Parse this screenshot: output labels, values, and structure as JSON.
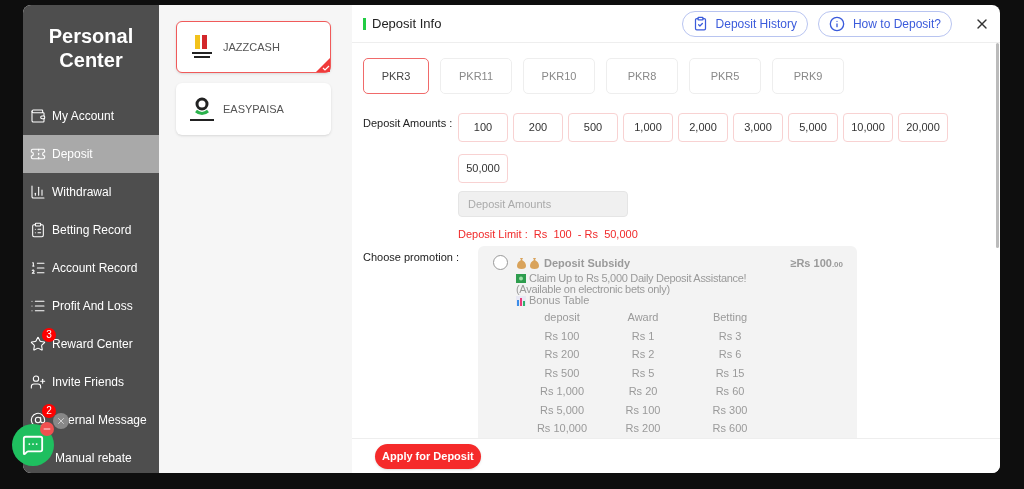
{
  "sidebar": {
    "title": "Personal Center",
    "items": [
      {
        "label": "My Account",
        "selected": false
      },
      {
        "label": "Deposit",
        "selected": true
      },
      {
        "label": "Withdrawal",
        "selected": false
      },
      {
        "label": "Betting Record",
        "selected": false
      },
      {
        "label": "Account Record",
        "selected": false
      },
      {
        "label": "Profit And Loss",
        "selected": false
      },
      {
        "label": "Reward Center",
        "selected": false,
        "badge": "3"
      },
      {
        "label": "Invite Friends",
        "selected": false
      },
      {
        "label": "ernal Message",
        "selected": false,
        "badge": "2"
      },
      {
        "label": "Manual rebate",
        "selected": false
      }
    ]
  },
  "channels": [
    {
      "name": "JAZZCASH",
      "selected": true
    },
    {
      "name": "EASYPAISA",
      "selected": false
    }
  ],
  "header": {
    "title": "Deposit Info",
    "buttons": [
      "Deposit History",
      "How to Deposit?"
    ]
  },
  "currencies": [
    {
      "label": "PKR3",
      "selected": true
    },
    {
      "label": "PKR11",
      "selected": false
    },
    {
      "label": "PKR10",
      "selected": false
    },
    {
      "label": "PKR8",
      "selected": false
    },
    {
      "label": "PKR5",
      "selected": false
    },
    {
      "label": "PRK9",
      "selected": false
    }
  ],
  "amounts": {
    "label": "Deposit Amounts :",
    "options": [
      "100",
      "200",
      "500",
      "1,000",
      "2,000",
      "3,000",
      "5,000",
      "10,000",
      "20,000",
      "50,000"
    ]
  },
  "amount_field": {
    "placeholder": "Deposit Amounts"
  },
  "limit": {
    "label": "Deposit Limit :",
    "range": "Rs  100  - Rs  50,000"
  },
  "promotion": {
    "label": "Choose promotion :",
    "card": {
      "checked": false,
      "title": "Deposit Subsidy",
      "min_prefix": "≥Rs",
      "min_amount": "100",
      "min_fraction": ".00",
      "claim": "Claim Up to Rs 5,000 Daily Deposit Assistance!",
      "note": "(Available on electronic bets only)",
      "table_title": "Bonus Table",
      "columns": [
        "deposit",
        "Award",
        "Betting"
      ],
      "rows": [
        [
          "Rs 100",
          "Rs 1",
          "Rs 3"
        ],
        [
          "Rs 200",
          "Rs 2",
          "Rs 6"
        ],
        [
          "Rs 500",
          "Rs 5",
          "Rs 15"
        ],
        [
          "Rs 1,000",
          "Rs 20",
          "Rs 60"
        ],
        [
          "Rs 5,000",
          "Rs 100",
          "Rs 300"
        ],
        [
          "Rs 10,000",
          "Rs 200",
          "Rs 600"
        ]
      ]
    }
  },
  "apply_button": "Apply for Deposit"
}
